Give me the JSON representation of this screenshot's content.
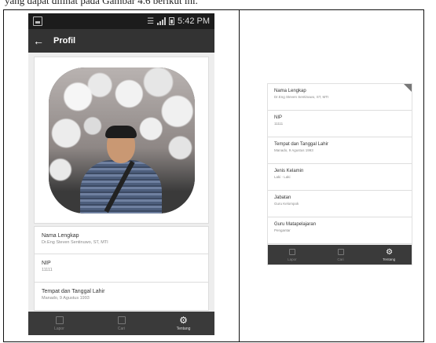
{
  "caption": "yang dapat dilihat pada Gambar 4.6 berikut ini.",
  "status_bar": {
    "time": "5:42 PM"
  },
  "app_bar": {
    "title": "Profil",
    "back_icon": "arrow-left-icon"
  },
  "profile_fields": [
    {
      "label": "Nama Lengkap",
      "value": "Dr.Eng Steven Sentinuwo, ST, MTI"
    },
    {
      "label": "NIP",
      "value": "11111"
    },
    {
      "label": "Tempat dan Tanggal Lahir",
      "value": "Manado, 9 Agustus 1993"
    },
    {
      "label": "Jenis Kelamin",
      "value": "Laki - Laki"
    },
    {
      "label": "Jabatan",
      "value": "Guru Kelompok"
    },
    {
      "label": "Guru Matapelajaran",
      "value": "Pengantar"
    }
  ],
  "bottom_nav": [
    {
      "label": "Lapor",
      "icon": "edit-icon",
      "active": false
    },
    {
      "label": "Cari",
      "icon": "calendar-icon",
      "active": false
    },
    {
      "label": "Tentang",
      "icon": "gear-icon",
      "active": true
    }
  ],
  "colors": {
    "app_bar": "#333333",
    "status_bar": "#1c1c1c",
    "bottom_nav": "#3a3a3a",
    "background": "#ededed"
  }
}
